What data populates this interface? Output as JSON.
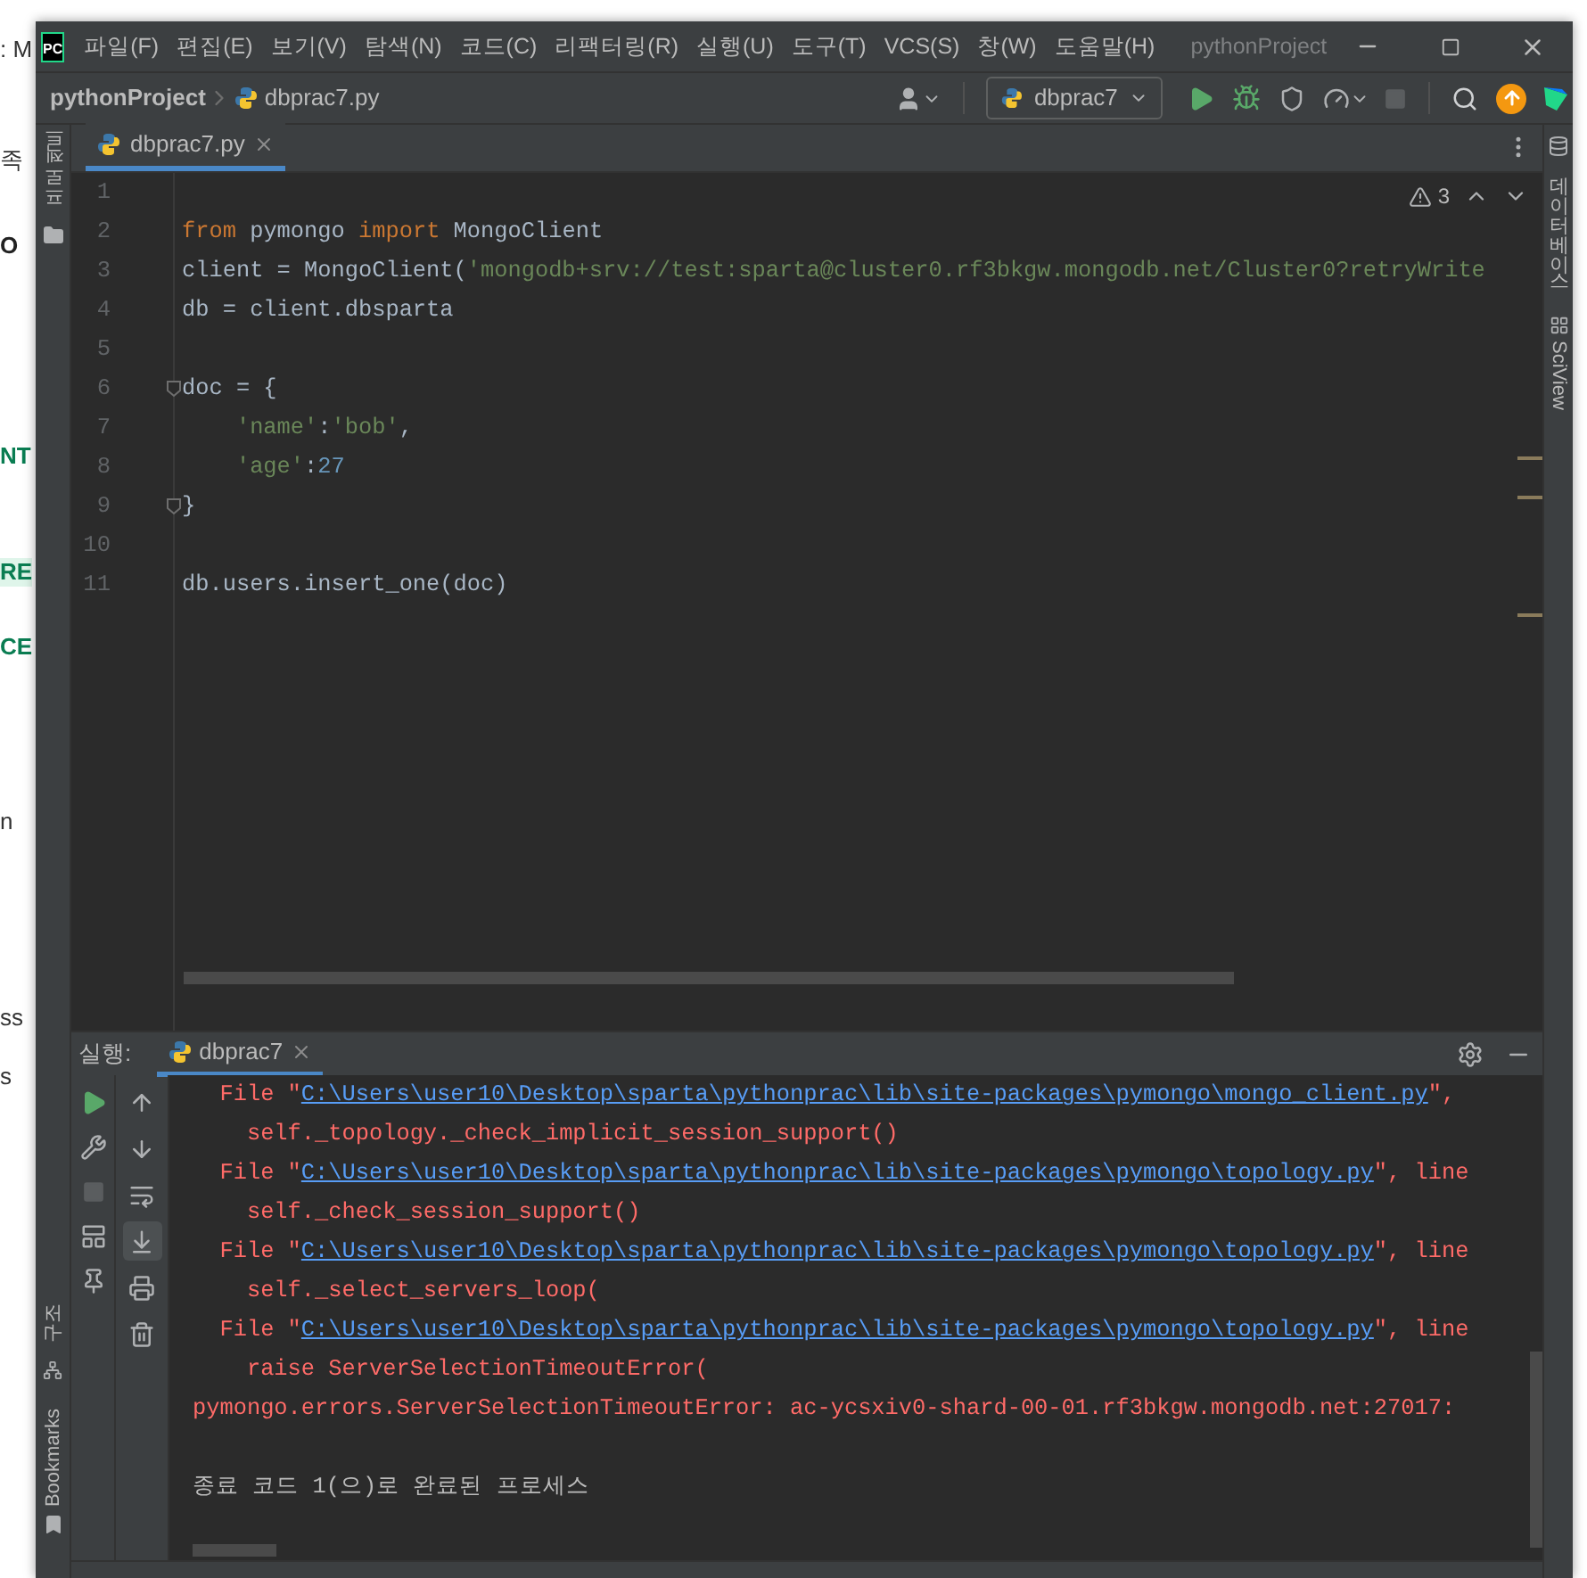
{
  "background_fragments": [
    {
      "text": ": M",
      "kind": "plain"
    },
    {
      "text": "족",
      "kind": "plain"
    },
    {
      "text": "O",
      "kind": "bold"
    },
    {
      "text": "NT",
      "kind": "accent"
    },
    {
      "text": "RE",
      "kind": "highlight"
    },
    {
      "text": "CE",
      "kind": "accent"
    },
    {
      "text": "n",
      "kind": "plain"
    },
    {
      "text": "ss",
      "kind": "plain"
    },
    {
      "text": "s",
      "kind": "plain"
    }
  ],
  "window": {
    "logo": "PC",
    "title": "pythonProject",
    "menu": [
      "파일(F)",
      "편집(E)",
      "보기(V)",
      "탐색(N)",
      "코드(C)",
      "리팩터링(R)",
      "실행(U)",
      "도구(T)",
      "VCS(S)",
      "창(W)",
      "도움말(H)"
    ]
  },
  "breadcrumb": [
    "pythonProject",
    "dbprac7.py"
  ],
  "run_config": {
    "label": "dbprac7"
  },
  "left_tool_windows": [
    "프로젝트",
    "구조",
    "Bookmarks"
  ],
  "right_tool_windows": [
    "데이터베이스",
    "SciView"
  ],
  "editor_tabs": [
    {
      "label": "dbprac7.py",
      "selected": true
    }
  ],
  "editor": {
    "warnings": "3",
    "lines": [
      {
        "number": "1"
      },
      {
        "number": "2",
        "tokens": [
          {
            "kind": "keyword",
            "text": "from"
          },
          {
            "kind": "plain",
            "text": " pymongo "
          },
          {
            "kind": "keyword",
            "text": "import"
          },
          {
            "kind": "plain",
            "text": " MongoClient"
          }
        ]
      },
      {
        "number": "3",
        "tokens": [
          {
            "kind": "plain",
            "text": "client = MongoClient("
          },
          {
            "kind": "string",
            "text": "'mongodb+srv://test:sparta@cluster0.rf3bkgw.mongodb.net/Cluster0?retryWrite"
          }
        ]
      },
      {
        "number": "4",
        "tokens": [
          {
            "kind": "plain",
            "text": "db = client.dbsparta"
          }
        ]
      },
      {
        "number": "5"
      },
      {
        "number": "6",
        "fold": true,
        "tokens": [
          {
            "kind": "plain",
            "text": "doc = {"
          }
        ]
      },
      {
        "number": "7",
        "tokens": [
          {
            "kind": "string",
            "text": "    'name'"
          },
          {
            "kind": "plain",
            "text": ":"
          },
          {
            "kind": "string",
            "text": "'bob'"
          },
          {
            "kind": "plain",
            "text": ","
          }
        ]
      },
      {
        "number": "8",
        "tokens": [
          {
            "kind": "string",
            "text": "    'age'"
          },
          {
            "kind": "plain",
            "text": ":"
          },
          {
            "kind": "number",
            "text": "27"
          }
        ]
      },
      {
        "number": "9",
        "fold": true,
        "tokens": [
          {
            "kind": "plain",
            "text": "}"
          }
        ]
      },
      {
        "number": "10"
      },
      {
        "number": "11",
        "tokens": [
          {
            "kind": "plain",
            "text": "db.users.insert_one(doc)"
          }
        ]
      }
    ]
  },
  "run_panel": {
    "label": "실행:",
    "tabs": [
      {
        "label": "dbprac7",
        "selected": true
      }
    ],
    "left_toolbar": [
      {
        "kind": "rerun",
        "disabled": false
      },
      {
        "kind": "wrench",
        "disabled": false
      },
      {
        "kind": "stop",
        "disabled": true
      },
      {
        "kind": "layout",
        "disabled": false
      },
      {
        "kind": "pin",
        "disabled": false
      }
    ],
    "output_toolbar": [
      {
        "kind": "up",
        "on": false
      },
      {
        "kind": "down",
        "on": false
      },
      {
        "kind": "wrap",
        "on": false
      },
      {
        "kind": "scroll-end",
        "on": true
      },
      {
        "kind": "print",
        "on": false
      },
      {
        "kind": "delete",
        "on": false
      }
    ],
    "output": [
      {
        "kind": "error",
        "segments": [
          {
            "kind": "text",
            "text": "  File \""
          },
          {
            "kind": "link",
            "text": "C:\\Users\\user10\\Desktop\\sparta\\pythonprac\\lib\\site-packages\\pymongo\\mongo_client.py"
          },
          {
            "kind": "text",
            "text": "\","
          }
        ]
      },
      {
        "kind": "error",
        "segments": [
          {
            "kind": "text",
            "text": "    self._topology._check_implicit_session_support()"
          }
        ]
      },
      {
        "kind": "error",
        "segments": [
          {
            "kind": "text",
            "text": "  File \""
          },
          {
            "kind": "link",
            "text": "C:\\Users\\user10\\Desktop\\sparta\\pythonprac\\lib\\site-packages\\pymongo\\topology.py"
          },
          {
            "kind": "text",
            "text": "\", line"
          }
        ]
      },
      {
        "kind": "error",
        "segments": [
          {
            "kind": "text",
            "text": "    self._check_session_support()"
          }
        ]
      },
      {
        "kind": "error",
        "segments": [
          {
            "kind": "text",
            "text": "  File \""
          },
          {
            "kind": "link",
            "text": "C:\\Users\\user10\\Desktop\\sparta\\pythonprac\\lib\\site-packages\\pymongo\\topology.py"
          },
          {
            "kind": "text",
            "text": "\", line"
          }
        ]
      },
      {
        "kind": "error",
        "segments": [
          {
            "kind": "text",
            "text": "    self._select_servers_loop("
          }
        ]
      },
      {
        "kind": "error",
        "segments": [
          {
            "kind": "text",
            "text": "  File \""
          },
          {
            "kind": "link",
            "text": "C:\\Users\\user10\\Desktop\\sparta\\pythonprac\\lib\\site-packages\\pymongo\\topology.py"
          },
          {
            "kind": "text",
            "text": "\", line"
          }
        ]
      },
      {
        "kind": "error",
        "segments": [
          {
            "kind": "text",
            "text": "    raise ServerSelectionTimeoutError("
          }
        ]
      },
      {
        "kind": "error",
        "segments": [
          {
            "kind": "text",
            "text": "pymongo.errors.ServerSelectionTimeoutError: ac-ycsxiv0-shard-00-01.rf3bkgw.mongodb.net:27017:"
          }
        ]
      },
      {
        "kind": "exit",
        "segments": [
          {
            "kind": "text",
            "text": "종료 코드 1(으)로 완료된 프로세스"
          }
        ]
      }
    ]
  }
}
